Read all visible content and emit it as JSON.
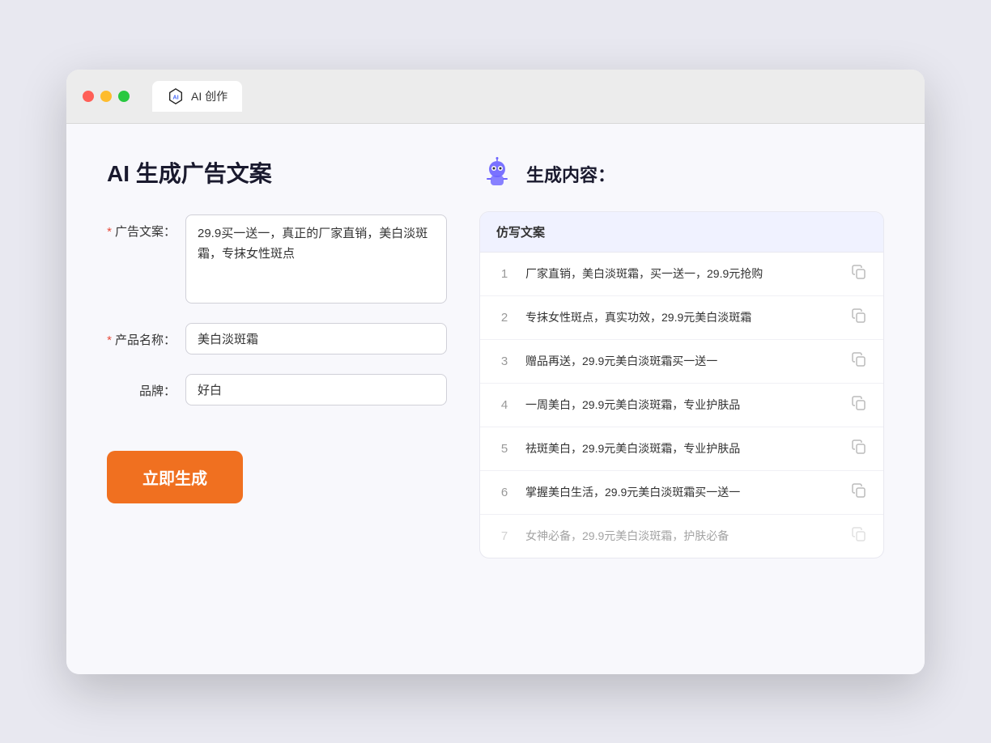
{
  "browser": {
    "tab_label": "AI 创作"
  },
  "page": {
    "title": "AI 生成广告文案",
    "result_title": "生成内容："
  },
  "form": {
    "ad_copy_label": "广告文案：",
    "ad_copy_required": true,
    "ad_copy_value": "29.9买一送一，真正的厂家直销，美白淡斑霜，专抹女性斑点",
    "product_name_label": "产品名称：",
    "product_name_required": true,
    "product_name_value": "美白淡斑霜",
    "brand_label": "品牌：",
    "brand_required": false,
    "brand_value": "好白",
    "generate_btn": "立即生成"
  },
  "table": {
    "header": "仿写文案",
    "rows": [
      {
        "num": "1",
        "text": "厂家直销，美白淡斑霜，买一送一，29.9元抢购",
        "dimmed": false
      },
      {
        "num": "2",
        "text": "专抹女性斑点，真实功效，29.9元美白淡斑霜",
        "dimmed": false
      },
      {
        "num": "3",
        "text": "赠品再送，29.9元美白淡斑霜买一送一",
        "dimmed": false
      },
      {
        "num": "4",
        "text": "一周美白，29.9元美白淡斑霜，专业护肤品",
        "dimmed": false
      },
      {
        "num": "5",
        "text": "祛斑美白，29.9元美白淡斑霜，专业护肤品",
        "dimmed": false
      },
      {
        "num": "6",
        "text": "掌握美白生活，29.9元美白淡斑霜买一送一",
        "dimmed": false
      },
      {
        "num": "7",
        "text": "女神必备，29.9元美白淡斑霜，护肤必备",
        "dimmed": true
      }
    ]
  }
}
